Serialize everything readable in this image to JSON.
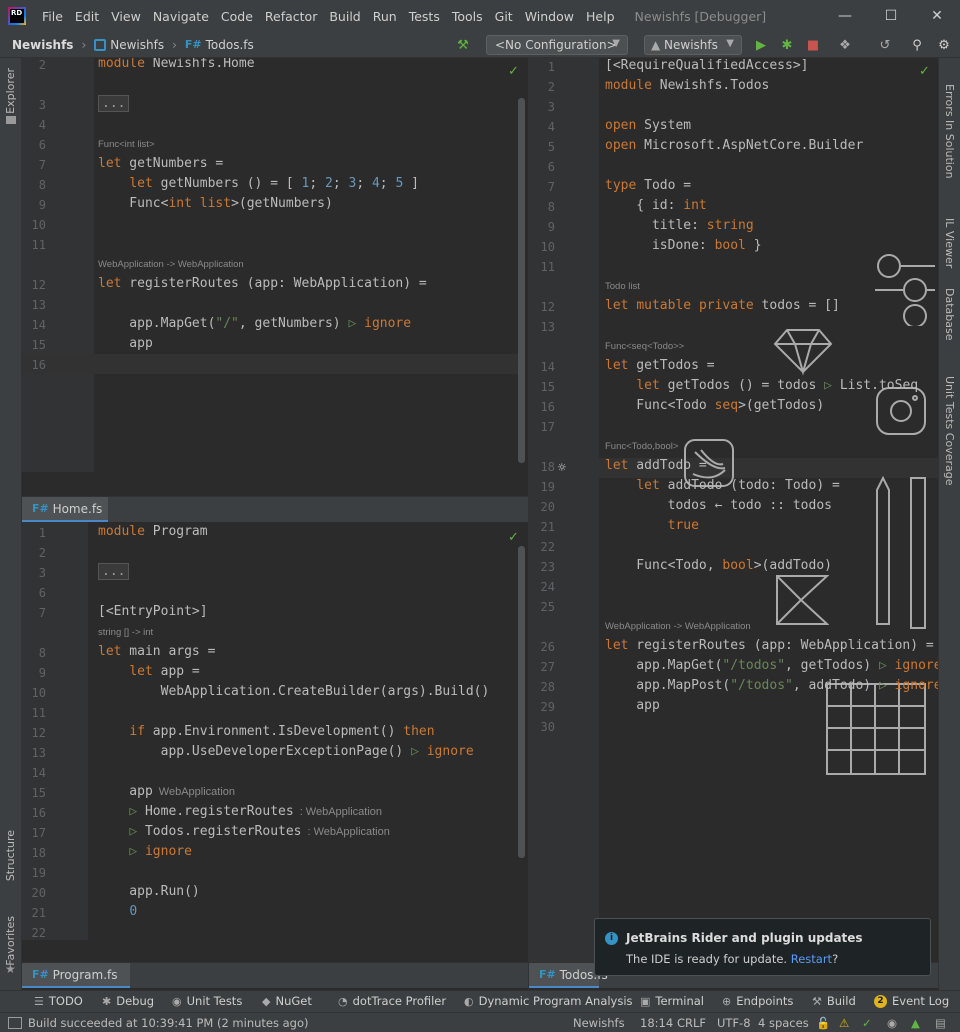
{
  "app": {
    "logo_text": "RD",
    "window_title": "Newishfs [Debugger]",
    "menu": [
      "File",
      "Edit",
      "View",
      "Navigate",
      "Code",
      "Refactor",
      "Build",
      "Run",
      "Tests",
      "Tools",
      "Git",
      "Window",
      "Help"
    ]
  },
  "navbar": {
    "breadcrumb": [
      "Newishfs",
      "Newishfs",
      "Todos.fs"
    ],
    "fs_badge": "F#",
    "configuration": "<No Configuration>",
    "run_target": "Newishfs"
  },
  "left_strip": {
    "top": [
      "Explorer"
    ],
    "bottom": [
      "Structure",
      "Favorites"
    ]
  },
  "right_strip": [
    "Errors In Solution",
    "IL Viewer",
    "Database",
    "Unit Tests Coverage"
  ],
  "editor_top_left": {
    "lines": [
      {
        "n": "2",
        "code": "module Newishfs.Home"
      },
      {
        "n": "3",
        "code": "..."
      },
      {
        "n": "4",
        "code": ""
      },
      {
        "n": "6",
        "code": ""
      },
      {
        "n": "7",
        "code": "let getNumbers =",
        "hint": "Func<int list>"
      },
      {
        "n": "8",
        "code": "    let getNumbers () = [ 1; 2; 3; 4; 5 ]"
      },
      {
        "n": "9",
        "code": "    Func<int list>(getNumbers)"
      },
      {
        "n": "10",
        "code": ""
      },
      {
        "n": "11",
        "code": ""
      },
      {
        "n": "12",
        "code": "let registerRoutes (app: WebApplication) =",
        "hint": "WebApplication -> WebApplication"
      },
      {
        "n": "13",
        "code": ""
      },
      {
        "n": "14",
        "code": "    app.MapGet(\"/\", getNumbers) ▷ ignore"
      },
      {
        "n": "15",
        "code": "    app"
      },
      {
        "n": "16",
        "code": ""
      }
    ]
  },
  "editor_bottom_left": {
    "tab": "Home.fs",
    "lines": [
      {
        "n": "1",
        "code": "module Program"
      },
      {
        "n": "2",
        "code": ""
      },
      {
        "n": "3",
        "code": "..."
      },
      {
        "n": "6",
        "code": ""
      },
      {
        "n": "7",
        "code": "[<EntryPoint>]"
      },
      {
        "n": "8",
        "code": "let main args =",
        "hint": "string [] -> int"
      },
      {
        "n": "9",
        "code": "    let app ="
      },
      {
        "n": "10",
        "code": "        WebApplication.CreateBuilder(args).Build()"
      },
      {
        "n": "11",
        "code": ""
      },
      {
        "n": "12",
        "code": "    if app.Environment.IsDevelopment() then"
      },
      {
        "n": "13",
        "code": "        app.UseDeveloperExceptionPage() ▷ ignore"
      },
      {
        "n": "14",
        "code": ""
      },
      {
        "n": "15",
        "code": "    app",
        "inline": "WebApplication"
      },
      {
        "n": "16",
        "code": "    ▷ Home.registerRoutes",
        "inline": ": WebApplication"
      },
      {
        "n": "17",
        "code": "    ▷ Todos.registerRoutes",
        "inline": ": WebApplication"
      },
      {
        "n": "18",
        "code": "    ▷ ignore"
      },
      {
        "n": "19",
        "code": ""
      },
      {
        "n": "20",
        "code": "    app.Run()"
      },
      {
        "n": "21",
        "code": "    0"
      },
      {
        "n": "22",
        "code": ""
      }
    ]
  },
  "editor_right": {
    "tab": "Todos.fs",
    "lines": [
      {
        "n": "1",
        "code": "[<RequireQualifiedAccess>]"
      },
      {
        "n": "2",
        "code": "module Newishfs.Todos"
      },
      {
        "n": "3",
        "code": ""
      },
      {
        "n": "4",
        "code": "open System"
      },
      {
        "n": "5",
        "code": "open Microsoft.AspNetCore.Builder"
      },
      {
        "n": "6",
        "code": ""
      },
      {
        "n": "7",
        "code": "type Todo ="
      },
      {
        "n": "8",
        "code": "    { id: int"
      },
      {
        "n": "9",
        "code": "      title: string"
      },
      {
        "n": "10",
        "code": "      isDone: bool }"
      },
      {
        "n": "11",
        "code": ""
      },
      {
        "n": "12",
        "code": "let mutable private todos = []",
        "hint": "Todo list"
      },
      {
        "n": "13",
        "code": ""
      },
      {
        "n": "14",
        "code": "let getTodos =",
        "hint": "Func<seq<Todo>>"
      },
      {
        "n": "15",
        "code": "    let getTodos () = todos ▷ List.toSeq"
      },
      {
        "n": "16",
        "code": "    Func<Todo seq>(getTodos)"
      },
      {
        "n": "17",
        "code": ""
      },
      {
        "n": "18",
        "code": "let addTodo =",
        "hint": "Func<Todo,bool>"
      },
      {
        "n": "19",
        "code": "    let addTodo (todo: Todo) ="
      },
      {
        "n": "20",
        "code": "        todos ← todo :: todos"
      },
      {
        "n": "21",
        "code": "        true"
      },
      {
        "n": "22",
        "code": ""
      },
      {
        "n": "23",
        "code": "    Func<Todo, bool>(addTodo)"
      },
      {
        "n": "24",
        "code": ""
      },
      {
        "n": "25",
        "code": ""
      },
      {
        "n": "26",
        "code": "let registerRoutes (app: WebApplication) =",
        "hint": "WebApplication -> WebApplication"
      },
      {
        "n": "27",
        "code": "    app.MapGet(\"/todos\", getTodos) ▷ ignore"
      },
      {
        "n": "28",
        "code": "    app.MapPost(\"/todos\", addTodo) ▷ ignore"
      },
      {
        "n": "29",
        "code": "    app"
      },
      {
        "n": "30",
        "code": ""
      }
    ]
  },
  "tabs": {
    "program": "Program.fs",
    "todos": "Todos.fs"
  },
  "tool_windows": [
    "TODO",
    "Debug",
    "Unit Tests",
    "NuGet",
    "dotTrace Profiler",
    "Dynamic Program Analysis",
    "Terminal",
    "Endpoints",
    "Build",
    "Event Log"
  ],
  "event_log_count": "2",
  "status": {
    "message": "Build succeeded at 10:39:41 PM  (2 minutes ago)",
    "project": "Newishfs",
    "position": "18:14",
    "line_ending": "CRLF",
    "encoding": "UTF-8",
    "indent": "4 spaces"
  },
  "notification": {
    "title": "JetBrains Rider and plugin updates",
    "message": "The IDE is ready for update.",
    "link": "Restart",
    "suffix": "?"
  }
}
